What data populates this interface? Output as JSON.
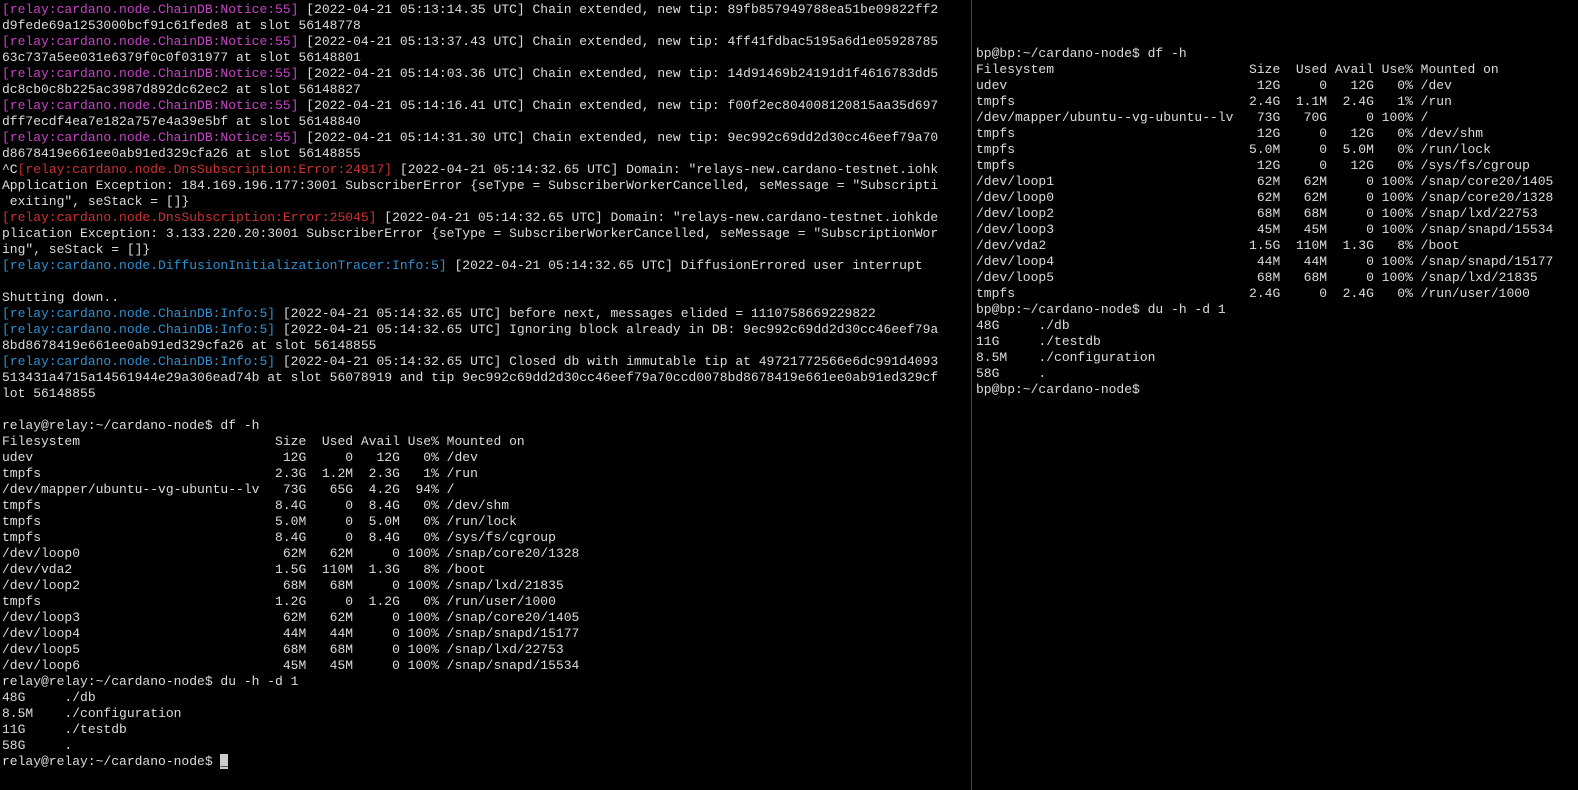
{
  "left": {
    "log": [
      {
        "tag": "[relay:cardano.node.ChainDB:Notice:55]",
        "cls": "tag-notice",
        "ts": "[2022-04-21 05:13:14.35 UTC]",
        "msg": " Chain extended, new tip: 89fb857949788ea51be09822ff2"
      },
      {
        "cont": "d9fede69a1253000bcf91c61fede8 at slot 56148778"
      },
      {
        "tag": "[relay:cardano.node.ChainDB:Notice:55]",
        "cls": "tag-notice",
        "ts": "[2022-04-21 05:13:37.43 UTC]",
        "msg": " Chain extended, new tip: 4ff41fdbac5195a6d1e05928785"
      },
      {
        "cont": "63c737a5ee031e6379f0c0f031977 at slot 56148801"
      },
      {
        "tag": "[relay:cardano.node.ChainDB:Notice:55]",
        "cls": "tag-notice",
        "ts": "[2022-04-21 05:14:03.36 UTC]",
        "msg": " Chain extended, new tip: 14d91469b24191d1f4616783dd5"
      },
      {
        "cont": "dc8cb0c8b225ac3987d892dc62ec2 at slot 56148827"
      },
      {
        "tag": "[relay:cardano.node.ChainDB:Notice:55]",
        "cls": "tag-notice",
        "ts": "[2022-04-21 05:14:16.41 UTC]",
        "msg": " Chain extended, new tip: f00f2ec804008120815aa35d697"
      },
      {
        "cont": "dff7ecdf4ea7e182a757e4a39e5bf at slot 56148840"
      },
      {
        "tag": "[relay:cardano.node.ChainDB:Notice:55]",
        "cls": "tag-notice",
        "ts": "[2022-04-21 05:14:31.30 UTC]",
        "msg": " Chain extended, new tip: 9ec992c69dd2d30cc46eef79a70"
      },
      {
        "cont": "d8678419e661ee0ab91ed329cfa26 at slot 56148855"
      },
      {
        "pre": "^C",
        "tag": "[relay:cardano.node.DnsSubscription:Error:24917]",
        "cls": "tag-error",
        "ts": "[2022-04-21 05:14:32.65 UTC]",
        "msg": " Domain: \"relays-new.cardano-testnet.iohk"
      },
      {
        "cont": "Application Exception: 184.169.196.177:3001 SubscriberError {seType = SubscriberWorkerCancelled, seMessage = \"Subscripti"
      },
      {
        "cont": " exiting\", seStack = []}"
      },
      {
        "tag": "[relay:cardano.node.DnsSubscription:Error:25045]",
        "cls": "tag-error",
        "ts": "[2022-04-21 05:14:32.65 UTC]",
        "msg": " Domain: \"relays-new.cardano-testnet.iohkde"
      },
      {
        "cont": "plication Exception: 3.133.220.20:3001 SubscriberError {seType = SubscriberWorkerCancelled, seMessage = \"SubscriptionWor"
      },
      {
        "cont": "ing\", seStack = []}"
      },
      {
        "tag": "[relay:cardano.node.DiffusionInitializationTracer:Info:5]",
        "cls": "tag-info",
        "ts": "[2022-04-21 05:14:32.65 UTC]",
        "msg": " DiffusionErrored user interrupt"
      },
      {
        "cont": ""
      },
      {
        "cont": "Shutting down.."
      },
      {
        "tag": "[relay:cardano.node.ChainDB:Info:5]",
        "cls": "tag-info",
        "ts": "[2022-04-21 05:14:32.65 UTC]",
        "msg": " before next, messages elided = 1110758669229822"
      },
      {
        "tag": "[relay:cardano.node.ChainDB:Info:5]",
        "cls": "tag-info",
        "ts": "[2022-04-21 05:14:32.65 UTC]",
        "msg": " Ignoring block already in DB: 9ec992c69dd2d30cc46eef79a"
      },
      {
        "cont": "8bd8678419e661ee0ab91ed329cfa26 at slot 56148855"
      },
      {
        "tag": "[relay:cardano.node.ChainDB:Info:5]",
        "cls": "tag-info",
        "ts": "[2022-04-21 05:14:32.65 UTC]",
        "msg": " Closed db with immutable tip at 49721772566e6dc991d4093"
      },
      {
        "cont": "513431a4715a14561944e29a306ead74b at slot 56078919 and tip 9ec992c69dd2d30cc46eef79a70ccd0078bd8678419e661ee0ab91ed329cf"
      },
      {
        "cont": "lot 56148855"
      }
    ],
    "prompt1": "relay@relay:~/cardano-node$ df -h",
    "df_header": "Filesystem                         Size  Used Avail Use% Mounted on",
    "df": [
      [
        "udev",
        " 12G",
        "   0",
        " 12G",
        "  0%",
        "/dev"
      ],
      [
        "tmpfs",
        "2.3G",
        "1.2M",
        "2.3G",
        "  1%",
        "/run"
      ],
      [
        "/dev/mapper/ubuntu--vg-ubuntu--lv",
        " 73G",
        " 65G",
        "4.2G",
        " 94%",
        "/"
      ],
      [
        "tmpfs",
        "8.4G",
        "   0",
        "8.4G",
        "  0%",
        "/dev/shm"
      ],
      [
        "tmpfs",
        "5.0M",
        "   0",
        "5.0M",
        "  0%",
        "/run/lock"
      ],
      [
        "tmpfs",
        "8.4G",
        "   0",
        "8.4G",
        "  0%",
        "/sys/fs/cgroup"
      ],
      [
        "/dev/loop0",
        " 62M",
        " 62M",
        "   0",
        "100%",
        "/snap/core20/1328"
      ],
      [
        "/dev/vda2",
        "1.5G",
        "110M",
        "1.3G",
        "  8%",
        "/boot"
      ],
      [
        "/dev/loop2",
        " 68M",
        " 68M",
        "   0",
        "100%",
        "/snap/lxd/21835"
      ],
      [
        "tmpfs",
        "1.2G",
        "   0",
        "1.2G",
        "  0%",
        "/run/user/1000"
      ],
      [
        "/dev/loop3",
        " 62M",
        " 62M",
        "   0",
        "100%",
        "/snap/core20/1405"
      ],
      [
        "/dev/loop4",
        " 44M",
        " 44M",
        "   0",
        "100%",
        "/snap/snapd/15177"
      ],
      [
        "/dev/loop5",
        " 68M",
        " 68M",
        "   0",
        "100%",
        "/snap/lxd/22753"
      ],
      [
        "/dev/loop6",
        " 45M",
        " 45M",
        "   0",
        "100%",
        "/snap/snapd/15534"
      ]
    ],
    "prompt2": "relay@relay:~/cardano-node$ du -h -d 1",
    "du": [
      "48G     ./db",
      "8.5M    ./configuration",
      "11G     ./testdb",
      "58G     ."
    ],
    "prompt3": "relay@relay:~/cardano-node$ ",
    "cursor": "_"
  },
  "right": {
    "prompt1": "bp@bp:~/cardano-node$ df -h",
    "df_header": "Filesystem                         Size  Used Avail Use% Mounted on",
    "df": [
      [
        "udev",
        " 12G",
        "   0",
        " 12G",
        "  0%",
        "/dev"
      ],
      [
        "tmpfs",
        "2.4G",
        "1.1M",
        "2.4G",
        "  1%",
        "/run"
      ],
      [
        "/dev/mapper/ubuntu--vg-ubuntu--lv",
        " 73G",
        " 70G",
        "   0",
        "100%",
        "/"
      ],
      [
        "tmpfs",
        " 12G",
        "   0",
        " 12G",
        "  0%",
        "/dev/shm"
      ],
      [
        "tmpfs",
        "5.0M",
        "   0",
        "5.0M",
        "  0%",
        "/run/lock"
      ],
      [
        "tmpfs",
        " 12G",
        "   0",
        " 12G",
        "  0%",
        "/sys/fs/cgroup"
      ],
      [
        "/dev/loop1",
        " 62M",
        " 62M",
        "   0",
        "100%",
        "/snap/core20/1405"
      ],
      [
        "/dev/loop0",
        " 62M",
        " 62M",
        "   0",
        "100%",
        "/snap/core20/1328"
      ],
      [
        "/dev/loop2",
        " 68M",
        " 68M",
        "   0",
        "100%",
        "/snap/lxd/22753"
      ],
      [
        "/dev/loop3",
        " 45M",
        " 45M",
        "   0",
        "100%",
        "/snap/snapd/15534"
      ],
      [
        "/dev/vda2",
        "1.5G",
        "110M",
        "1.3G",
        "  8%",
        "/boot"
      ],
      [
        "/dev/loop4",
        " 44M",
        " 44M",
        "   0",
        "100%",
        "/snap/snapd/15177"
      ],
      [
        "/dev/loop5",
        " 68M",
        " 68M",
        "   0",
        "100%",
        "/snap/lxd/21835"
      ],
      [
        "tmpfs",
        "2.4G",
        "   0",
        "2.4G",
        "  0%",
        "/run/user/1000"
      ]
    ],
    "prompt2": "bp@bp:~/cardano-node$ du -h -d 1",
    "du": [
      "48G     ./db",
      "11G     ./testdb",
      "8.5M    ./configuration",
      "58G     ."
    ],
    "prompt3": "bp@bp:~/cardano-node$"
  }
}
